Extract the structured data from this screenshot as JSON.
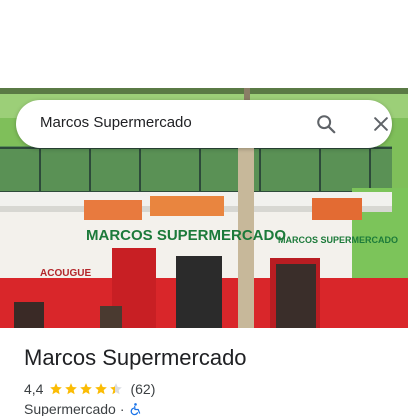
{
  "search": {
    "query": "Marcos Supermercado",
    "search_icon": "search-icon",
    "close_icon": "close-icon"
  },
  "photo": {
    "store_sign": "MARCOS SUPERMERCADO",
    "left_sign": "ACOUGUE",
    "right_sign": "MARCOS SUPERMERCADO"
  },
  "place": {
    "name": "Marcos Supermercado",
    "rating": "4,4",
    "stars": 4.4,
    "review_count": "(62)",
    "category": "Supermercado",
    "separator": "·",
    "accessibility_icon": "wheelchair-icon"
  },
  "colors": {
    "star": "#fbbc04",
    "star_empty": "#dadce0",
    "accessibility": "#1a73e8",
    "text_primary": "#202124",
    "text_secondary": "#3c4043"
  }
}
